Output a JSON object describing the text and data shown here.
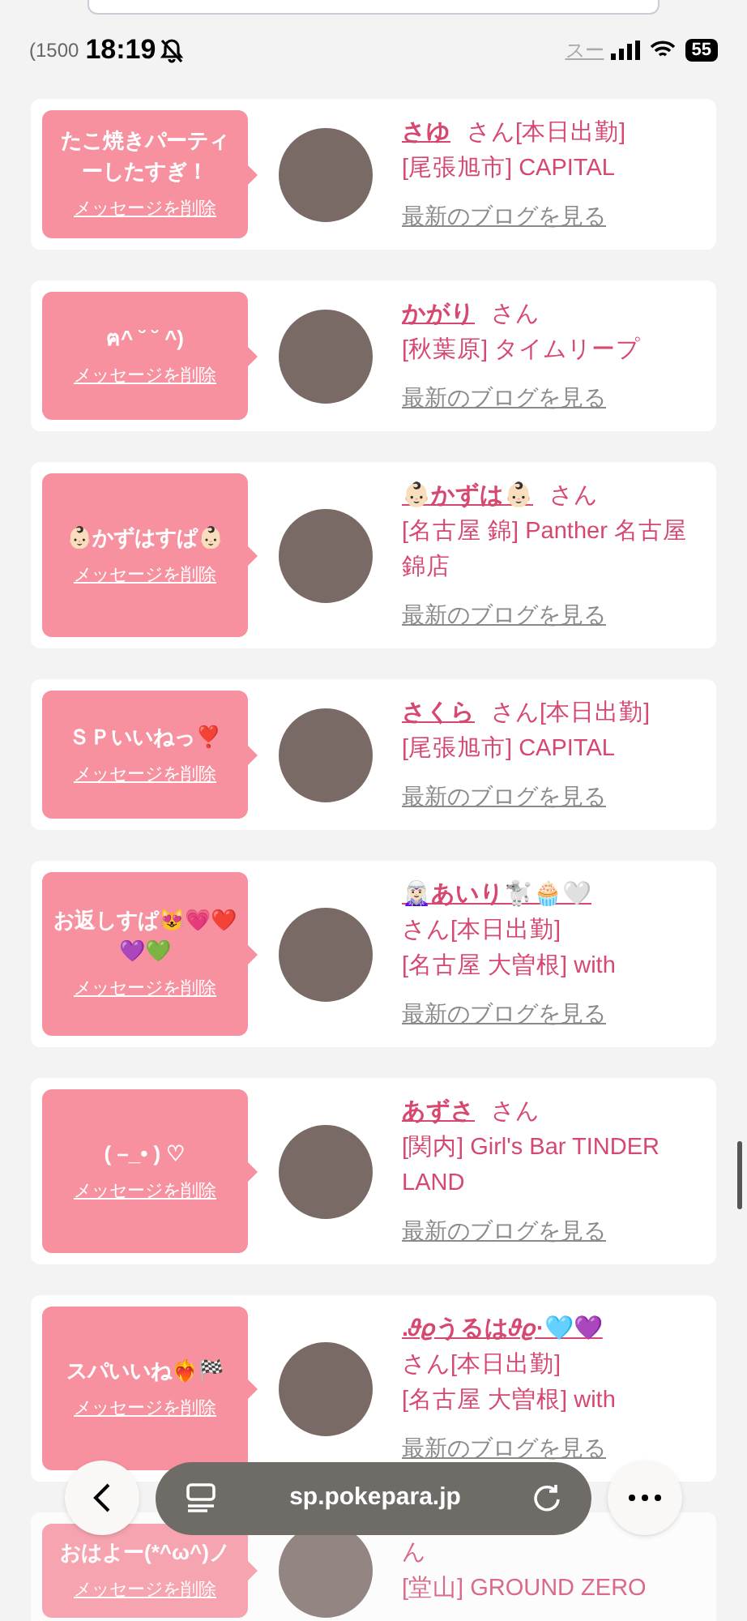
{
  "status_bar": {
    "time": "18:19",
    "battery": "55"
  },
  "header": {
    "count_text": "(1500",
    "help_link": "スー"
  },
  "cards": [
    {
      "message": "たこ焼きパーティーしたすぎ！",
      "delete": "メッセージを削除",
      "name": "さゆ",
      "suffix": "さん[本日出勤]",
      "shop": "[尾張旭市] CAPITAL",
      "blog": "最新のブログを見る"
    },
    {
      "message": "ฅ^ ˘ ˘ ^)",
      "delete": "メッセージを削除",
      "name": "かがり",
      "suffix": "さん",
      "shop": "[秋葉原] タイムリープ",
      "blog": "最新のブログを見る"
    },
    {
      "message": "👶🏻かずはすぱ👶🏻",
      "delete": "メッセージを削除",
      "name": "👶🏻かずは👶🏻",
      "suffix": "さん",
      "shop": "[名古屋 錦] Panther 名古屋錦店",
      "blog": "最新のブログを見る"
    },
    {
      "message": "ＳＰいいねっ❣️",
      "delete": "メッセージを削除",
      "name": "さくら",
      "suffix": "さん[本日出勤]",
      "shop": "[尾張旭市] CAPITAL",
      "blog": "最新のブログを見る"
    },
    {
      "message": "お返しすぱ😻💗❤️💜💚",
      "delete": "メッセージを削除",
      "name": "🧝🏻‍♀️あいり🐩🧁🤍",
      "suffix": "さん[本日出勤]",
      "shop": "[名古屋 大曽根] with",
      "blog": "最新のブログを見る"
    },
    {
      "message": "( –_• ) ♡",
      "delete": "メッセージを削除",
      "name": "あずさ",
      "suffix": "さん",
      "shop": "[関内] Girl's Bar TINDER LAND",
      "blog": "最新のブログを見る"
    },
    {
      "message": "スパいいね❤️‍🔥🏁",
      "delete": "メッセージを削除",
      "name": ".𝜗𝜚うるは𝜗𝜚·🩵💜",
      "suffix": "さん[本日出勤]",
      "shop": "[名古屋 大曽根] with",
      "blog": "最新のブログを見る"
    },
    {
      "message": "おはよー(*^ω^)ノ",
      "delete": "メッセージを削除",
      "suffix": "ん",
      "shop": "[堂山] GROUND ZERO"
    }
  ],
  "browser_bar": {
    "url": "sp.pokepara.jp"
  }
}
